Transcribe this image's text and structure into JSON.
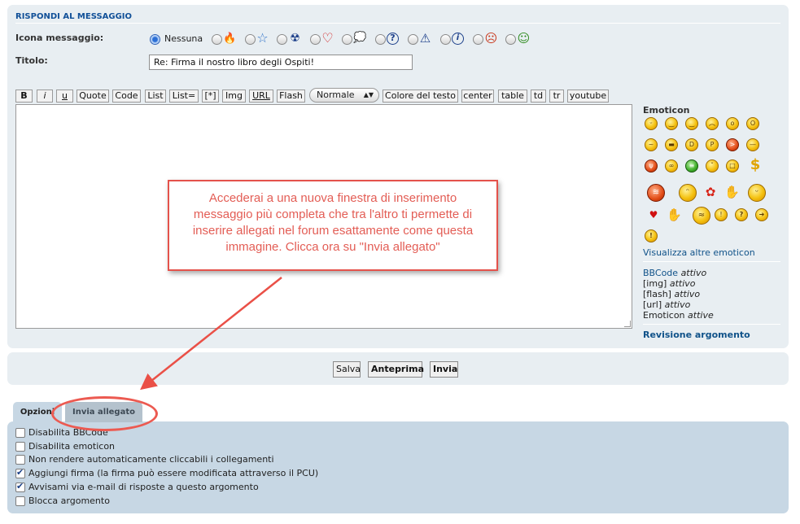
{
  "section": {
    "title": "RISPONDI AL MESSAGGIO"
  },
  "form": {
    "icon_label": "Icona messaggio:",
    "icon_options": [
      {
        "label": "Nessuna",
        "selected": true
      },
      {
        "icon": "fire-icon",
        "glyph": "🔥"
      },
      {
        "icon": "star-icon",
        "glyph": "☆"
      },
      {
        "icon": "radioactive-icon",
        "glyph": "☢"
      },
      {
        "icon": "heart-icon",
        "glyph": "♡"
      },
      {
        "icon": "speech-bubble-icon",
        "glyph": "💭"
      },
      {
        "icon": "question-icon",
        "glyph": "?"
      },
      {
        "icon": "warning-icon",
        "glyph": "⚠"
      },
      {
        "icon": "info-icon",
        "glyph": "i"
      },
      {
        "icon": "sad-face-icon",
        "glyph": "☹"
      },
      {
        "icon": "grin-face-icon",
        "glyph": "☺"
      }
    ],
    "title_label": "Titolo:",
    "title_value": "Re: Firma il nostro libro degli Ospiti!"
  },
  "toolbar": {
    "buttons": [
      "B",
      "i",
      "u",
      "Quote",
      "Code",
      "List",
      "List=",
      "[*]",
      "Img",
      "URL",
      "Flash"
    ],
    "size_select": "Normale",
    "buttons_after": [
      "Colore del testo",
      "center",
      "table",
      "td",
      "tr",
      "youtube"
    ]
  },
  "emoticons": {
    "title": "Emoticon",
    "more_link": "Visualizza altre emoticon"
  },
  "bbcode": {
    "lines": [
      {
        "name": "BBCode",
        "status": "attivo"
      },
      {
        "name": "[img]",
        "status": "attivo"
      },
      {
        "name": "[flash]",
        "status": "attivo"
      },
      {
        "name": "[url]",
        "status": "attivo"
      },
      {
        "name": "Emoticon",
        "status": "attive"
      }
    ],
    "review": "Revisione argomento"
  },
  "actions": {
    "save": "Salva",
    "preview": "Anteprima",
    "submit": "Invia"
  },
  "tabs": {
    "options": "Opzioni",
    "attachment": "Invia allegato"
  },
  "options": [
    {
      "label": "Disabilita BBCode",
      "checked": false
    },
    {
      "label": "Disabilita emoticon",
      "checked": false
    },
    {
      "label": "Non rendere automaticamente cliccabili i collegamenti",
      "checked": false
    },
    {
      "label": "Aggiungi firma (la firma può essere modificata attraverso il PCU)",
      "checked": true
    },
    {
      "label": "Avvisami via e-mail di risposte a questo argomento",
      "checked": true
    },
    {
      "label": "Blocca argomento",
      "checked": false
    }
  ],
  "annotation": {
    "text": "Accederai a una nuova finestra di inserimento messaggio più completa che tra l'altro ti permette di inserire allegati nel forum esattamente come questa immagine. Clicca ora su \"Invia allegato\"",
    "color": "#e4524b"
  }
}
